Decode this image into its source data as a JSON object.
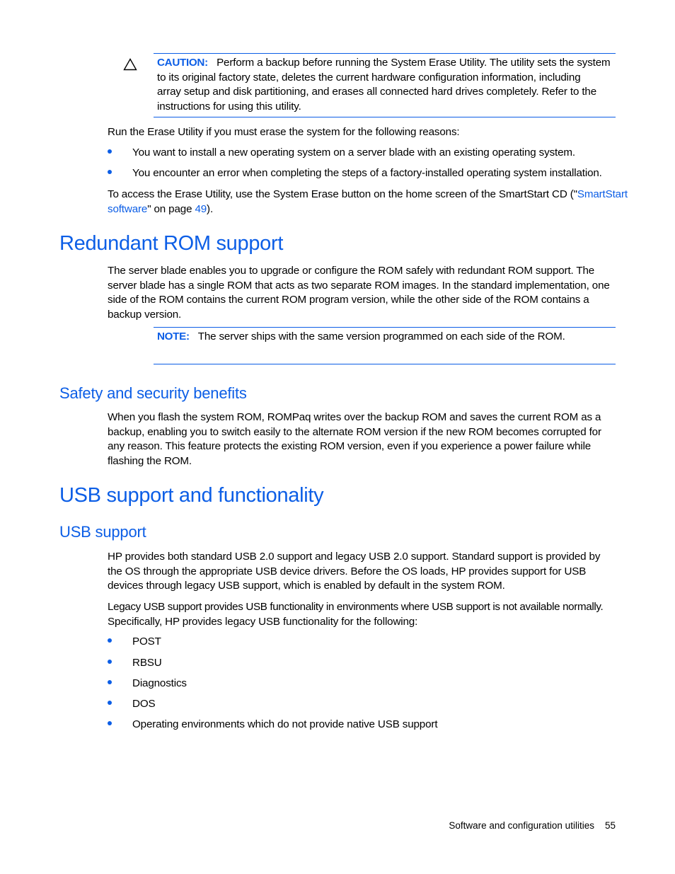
{
  "caution": {
    "icon": "warning-triangle-icon",
    "label": "CAUTION:",
    "text": "Perform a backup before running the System Erase Utility. The utility sets the system to its original factory state, deletes the current hardware configuration information, including array setup and disk partitioning, and erases all connected hard drives completely. Refer to the instructions for using this utility.",
    "lines": [
      "Perform a backup before running the System Erase Utility. The utility sets the system",
      "to its original factory state, deletes the current hardware configuration information, including",
      "array setup and disk partitioning, and erases all connected hard drives completely. Refer to the",
      "instructions for using this utility."
    ]
  },
  "erase_section": {
    "intro": "Run the Erase Utility if you must erase the system for the following reasons:",
    "bullets": [
      "You want to install a new operating system on a server blade with an existing operating system.",
      "You encounter an error when completing the steps of a factory-installed operating system installation."
    ],
    "access_line1_prefix": "To access the Erase Utility, use the System Erase button on the home screen of the SmartStart CD (\"",
    "access_link_part1": "SmartStart",
    "access_link_part2": "software",
    "access_mid": "\" on page ",
    "access_page_link": "49",
    "access_suffix": ")."
  },
  "redundant_rom": {
    "heading": "Redundant ROM support",
    "lines": [
      "The server blade enables you to upgrade or configure the ROM safely with redundant ROM support. The",
      "server blade has a single ROM that acts as two separate ROM images. In the standard implementation, one",
      "side of the ROM contains the current ROM program version, while the other side of the ROM contains a",
      "backup version."
    ],
    "note_label": "NOTE:",
    "note_text": "The server ships with the same version programmed on each side of the ROM."
  },
  "safety": {
    "heading": "Safety and security benefits",
    "lines": [
      "When you flash the system ROM, ROMPaq writes over the backup ROM and saves the current ROM as a",
      "backup, enabling you to switch easily to the alternate ROM version if the new ROM becomes corrupted for",
      "any reason. This feature protects the existing ROM version, even if you experience a power failure while",
      "flashing the ROM."
    ]
  },
  "usb": {
    "heading": "USB support and functionality",
    "subheading": "USB support",
    "para1_lines": [
      "HP provides both standard USB 2.0 support and legacy USB 2.0 support. Standard support is provided by",
      "the OS through the appropriate USB device drivers. Before the OS loads, HP provides support for USB",
      "devices through legacy USB support, which is enabled by default in the system ROM."
    ],
    "para2_lines": [
      "Legacy USB support provides USB functionality in environments where USB support is not available normally.",
      "Specifically, HP provides legacy USB functionality for the following:"
    ],
    "bullets": [
      "POST",
      "RBSU",
      "Diagnostics",
      "DOS",
      "Operating environments which do not provide native USB support"
    ]
  },
  "footer": {
    "section": "Software and configuration utilities",
    "page_number": "55"
  }
}
